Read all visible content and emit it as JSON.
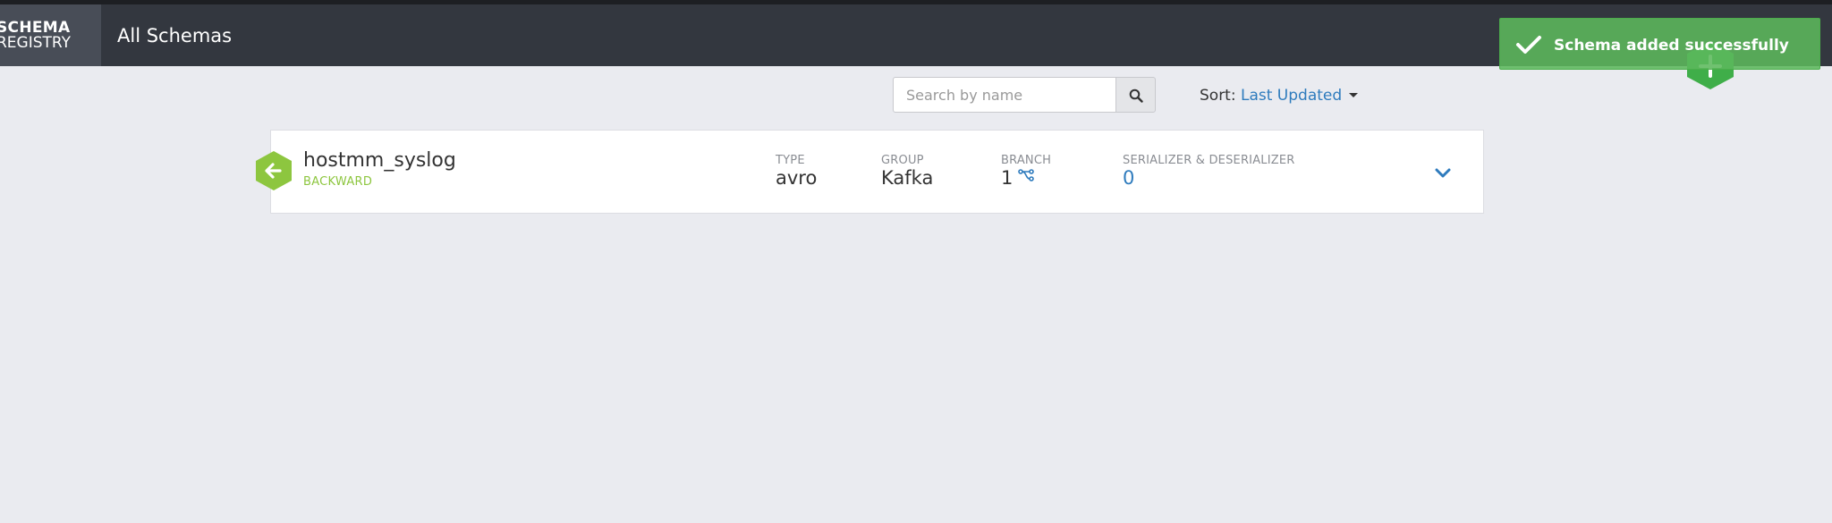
{
  "logo": {
    "line1": "SCHEMA",
    "line2": "REGISTRY"
  },
  "header": {
    "title": "All Schemas"
  },
  "search": {
    "placeholder": "Search by name",
    "value": ""
  },
  "sort": {
    "label": "Sort:",
    "value": "Last Updated"
  },
  "schemas": [
    {
      "name": "hostmm_syslog",
      "compatibility": "BACKWARD",
      "type_label": "TYPE",
      "type": "avro",
      "group_label": "GROUP",
      "group": "Kafka",
      "branch_label": "BRANCH",
      "branch": "1",
      "serdes_label": "SERIALIZER & DESERIALIZER",
      "serdes": "0"
    }
  ],
  "toast": {
    "message": "Schema added successfully",
    "icon": "check-icon"
  },
  "colors": {
    "topbar": "#33373f",
    "accent_link": "#2e7bbd",
    "compat_green": "#8dc63f",
    "toast_green": "#5cb85c"
  }
}
